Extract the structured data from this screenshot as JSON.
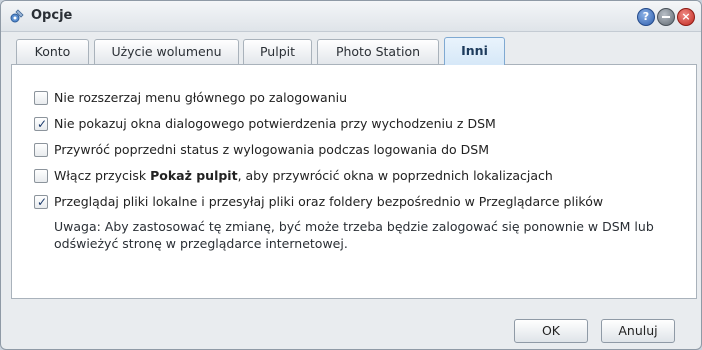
{
  "window": {
    "title": "Opcje",
    "icon": "settings-icon"
  },
  "titlebar_buttons": {
    "help": "?",
    "minimize": "",
    "close": "×"
  },
  "tabs": [
    {
      "label": "Konto",
      "active": false
    },
    {
      "label": "Użycie wolumenu",
      "active": false
    },
    {
      "label": "Pulpit",
      "active": false
    },
    {
      "label": "Photo Station",
      "active": false
    },
    {
      "label": "Inni",
      "active": true
    }
  ],
  "options": [
    {
      "label": "Nie rozszerzaj menu głównego po zalogowaniu",
      "checked": false
    },
    {
      "label": "Nie pokazuj okna dialogowego potwierdzenia przy wychodzeniu z DSM",
      "checked": true
    },
    {
      "label": "Przywróć poprzedni status z wylogowania podczas logowania do DSM",
      "checked": false
    },
    {
      "label_before": "Włącz przycisk ",
      "label_bold": "Pokaż pulpit",
      "label_after": ", aby przywrócić okna w poprzednich lokalizacjach",
      "checked": false
    },
    {
      "label": "Przeglądaj pliki lokalne i przesyłaj pliki oraz foldery bezpośrednio w Przeglądarce plików",
      "checked": true
    }
  ],
  "note": "Uwaga: Aby zastosować tę zmianę, być może trzeba będzie zalogować się ponownie w DSM lub odświeżyć stronę w przeglądarce internetowej.",
  "footer": {
    "ok_label": "OK",
    "cancel_label": "Anuluj"
  }
}
